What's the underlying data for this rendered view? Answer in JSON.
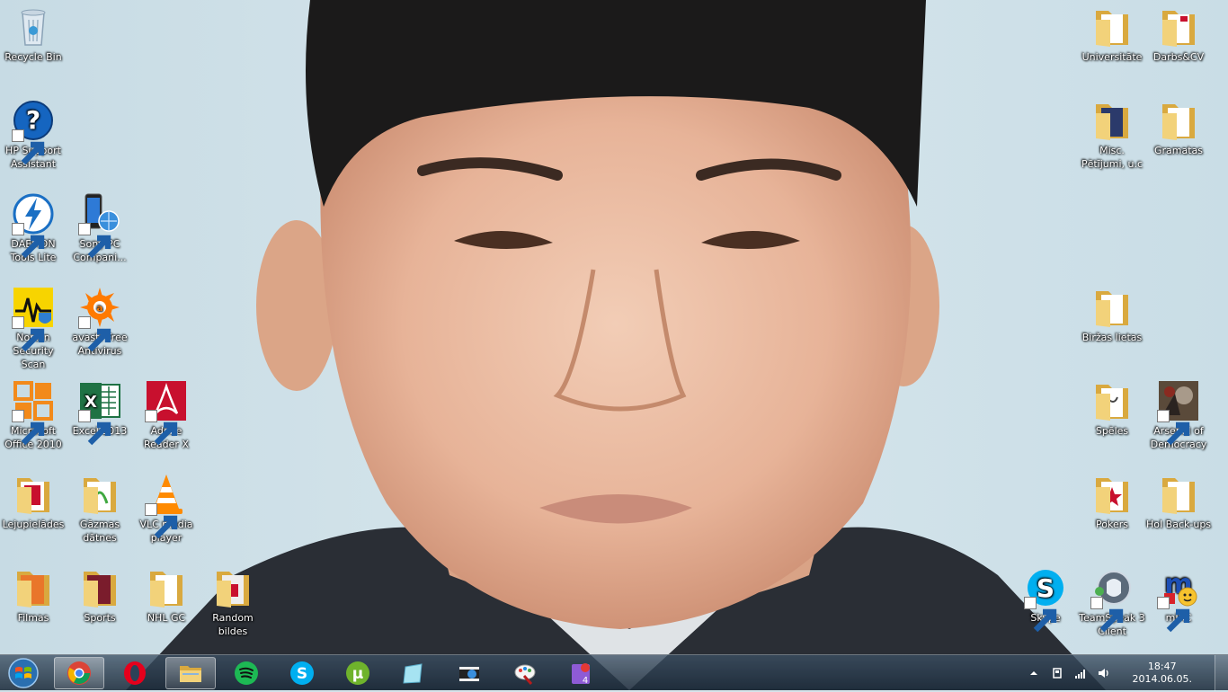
{
  "desktop": {
    "icons": [
      {
        "id": "recycle-bin",
        "label": "Recycle Bin"
      },
      {
        "id": "hp-support",
        "label": "HP Support Assistant"
      },
      {
        "id": "daemon-tools",
        "label": "DAEMON Tools Lite"
      },
      {
        "id": "sony-pc",
        "label": "Sony PC Compani..."
      },
      {
        "id": "norton",
        "label": "Norton Security Scan"
      },
      {
        "id": "avast",
        "label": "avast! Free Antivirus"
      },
      {
        "id": "ms-office",
        "label": "Microsoft Office 2010"
      },
      {
        "id": "excel",
        "label": "Excel 2013"
      },
      {
        "id": "adobe-reader",
        "label": "Adobe Reader X"
      },
      {
        "id": "lejupielades",
        "label": "Lejupielādes"
      },
      {
        "id": "gazmas",
        "label": "Gāzmas dātnes"
      },
      {
        "id": "vlc",
        "label": "VLC media player"
      },
      {
        "id": "filmas",
        "label": "Filmas"
      },
      {
        "id": "sports",
        "label": "Sports"
      },
      {
        "id": "nhl-gc",
        "label": "NHL GC"
      },
      {
        "id": "random-bildes",
        "label": "Random bildes"
      },
      {
        "id": "universitate",
        "label": "Universitāte"
      },
      {
        "id": "darbs-cv",
        "label": "Darbs&CV"
      },
      {
        "id": "misc",
        "label": "Misc. Pētījumi, u.c"
      },
      {
        "id": "gramatas",
        "label": "Gramatas"
      },
      {
        "id": "birzas",
        "label": "Biržas lietas"
      },
      {
        "id": "speles",
        "label": "Spēles"
      },
      {
        "id": "arsenal",
        "label": "Arsenal of Democracy"
      },
      {
        "id": "pokers",
        "label": "Pokers"
      },
      {
        "id": "hol-backups",
        "label": "HoI Back-ups"
      },
      {
        "id": "skype",
        "label": "Skype"
      },
      {
        "id": "teamspeak",
        "label": "TeamSpeak 3 Client"
      },
      {
        "id": "mirc",
        "label": "mIRC"
      }
    ]
  },
  "taskbar": {
    "pinned": [
      "chrome",
      "opera",
      "explorer",
      "spotify",
      "skype",
      "utorrent",
      "notes",
      "movie-maker",
      "paint",
      "hearts"
    ],
    "clock": {
      "time": "18:47",
      "date": "2014.06.05."
    }
  },
  "colors": {
    "folder": "#f2d27a",
    "folder_dark": "#d9a93f",
    "taskbar": "#2c4258"
  }
}
